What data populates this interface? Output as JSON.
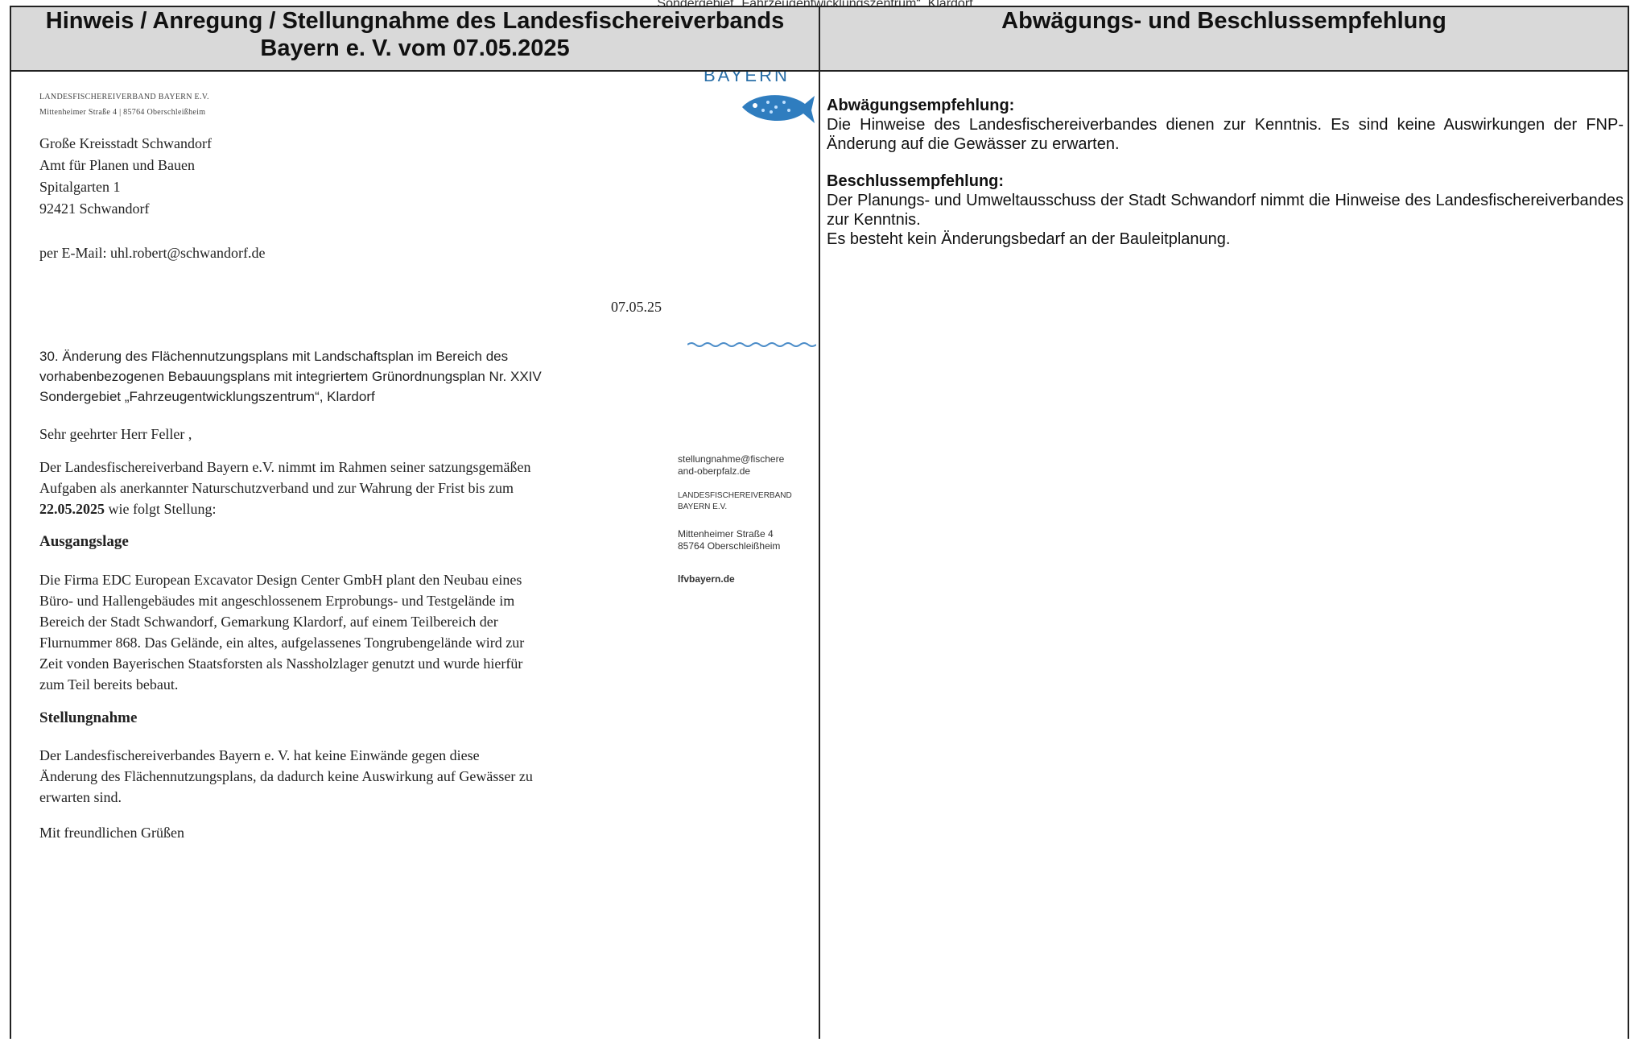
{
  "top_caption": "Sondergebiet „Fahrzeugentwicklungszentrum“, Klardorf",
  "table": {
    "left_header": "Hinweis / Anregung / Stellungnahme des Landesfischereiverbands Bayern e. V. vom 07.05.2025",
    "right_header": "Abwägungs- und Beschlussempfehlung"
  },
  "letter": {
    "logo_word": "BAYERN",
    "sender_name": "LANDESFISCHEREIVERBAND BAYERN E.V.",
    "sender_address": "Mittenheimer Straße 4 | 85764 Oberschleißheim",
    "recipient": [
      "Große Kreisstadt Schwandorf",
      "Amt für Planen und Bauen",
      "Spitalgarten 1",
      "92421 Schwandorf"
    ],
    "email_line": "per E-Mail: uhl.robert@schwandorf.de",
    "date": "07.05.25",
    "subject": [
      "30. Änderung des Flächennutzungsplans mit Landschaftsplan im Bereich des",
      "vorhabenbezogenen Bebauungsplans mit integriertem Grünordnungsplan Nr. XXIV",
      "Sondergebiet „Fahrzeugentwicklungszentrum“, Klardorf"
    ],
    "salutation": "Sehr geehrter Herr Feller ,",
    "intro": [
      "Der Landesfischereiverband Bayern e.V. nimmt im Rahmen seiner satzungsgemäßen",
      "Aufgaben als anerkannter Naturschutzverband und zur Wahrung der Frist bis zum"
    ],
    "intro_deadline": "22.05.2025",
    "intro_tail": " wie folgt Stellung:",
    "section1_title": "Ausgangslage",
    "section1_lines": [
      "Die Firma EDC European Excavator Design Center GmbH plant den Neubau eines",
      "Büro- und Hallengebäudes mit angeschlossenem Erprobungs- und Testgelände im",
      "Bereich der Stadt Schwandorf, Gemarkung Klardorf, auf einem Teilbereich der",
      "Flurnummer 868. Das Gelände, ein altes, aufgelassenes Tongrubengelände wird zur",
      "Zeit vonden Bayerischen Staatsforsten als Nassholzlager genutzt und wurde hierfür",
      "zum Teil bereits bebaut."
    ],
    "section2_title": "Stellungnahme",
    "section2_lines": [
      "Der Landesfischereiverbandes Bayern e. V. hat keine Einwände gegen diese",
      "Änderung des Flächennutzungsplans, da dadurch keine Auswirkung auf Gewässer zu",
      "erwarten sind."
    ],
    "closing": "Mit freundlichen Grüßen",
    "sidebar": {
      "email": [
        "stellungnahme@fischere",
        "and-oberpfalz.de"
      ],
      "org": [
        "LANDESFISCHEREIVERBAND",
        "BAYERN E.V."
      ],
      "address": [
        "Mittenheimer Straße 4",
        "85764 Oberschleißheim"
      ],
      "web": "lfvbayern.de"
    }
  },
  "recommendation": {
    "weighing_title": "Abwägungsempfehlung:",
    "weighing_text": "Die Hinweise des Landesfischereiverbandes dienen zur Kenntnis. Es sind keine Auswirkungen der FNP-Änderung auf die Gewässer zu erwarten.",
    "decision_title": "Beschlussempfehlung:",
    "decision_text": "Der Planungs- und Umweltausschuss der Stadt Schwandorf nimmt die Hinweise des Landesfischereiverbandes zur Kenntnis.",
    "decision_text2": "Es besteht kein Änderungsbedarf an der Bauleitplanung."
  },
  "colors": {
    "header_bg": "#d9d9d9",
    "logo_blue": "#2a6fa8",
    "border": "#222222"
  }
}
